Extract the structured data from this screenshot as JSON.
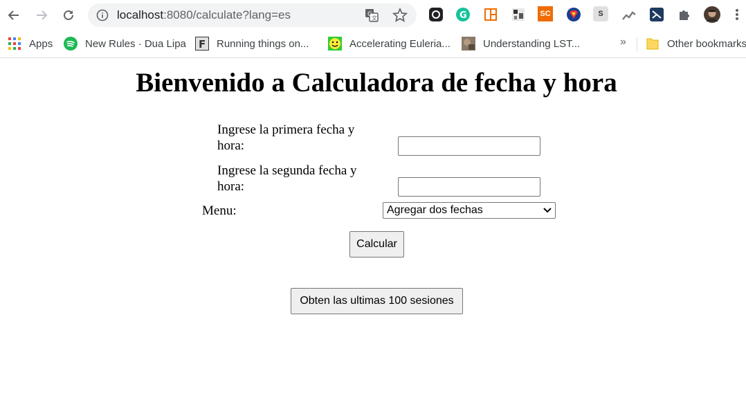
{
  "browser": {
    "url_host": "localhost",
    "url_rest": ":8080/calculate?lang=es",
    "bookmarks": [
      {
        "label": "Apps",
        "icon": "apps-grid-icon"
      },
      {
        "label": "New Rules · Dua Lipa",
        "icon": "spotify-icon"
      },
      {
        "label": "Running things on...",
        "icon": "f-favicon-icon"
      },
      {
        "label": "Accelerating Euleria...",
        "icon": "smiley-favicon-icon"
      },
      {
        "label": "Understanding LST...",
        "icon": "image-favicon-icon"
      }
    ],
    "other_bookmarks": "Other bookmarks",
    "overflow": "»",
    "extensions": {
      "sc_label": "SC",
      "s_label": "S"
    }
  },
  "page": {
    "title": "Bienvenido a Calculadora de fecha y hora",
    "first_date_label_line1": "Ingrese la primera fecha y",
    "first_date_label_line2": "hora:",
    "first_date_value": "",
    "second_date_label_line1": "Ingrese la segunda fecha y",
    "second_date_label_line2": "hora:",
    "second_date_value": "",
    "menu_label": "Menu:",
    "menu_selected": "Agregar dos fechas",
    "calculate_button": "Calcular",
    "sessions_button": "Obten las ultimas 100 sesiones"
  },
  "colors": {
    "accent_grammarly": "#15c39a",
    "accent_spotify": "#1db954",
    "accent_sc": "#ef6c00"
  }
}
